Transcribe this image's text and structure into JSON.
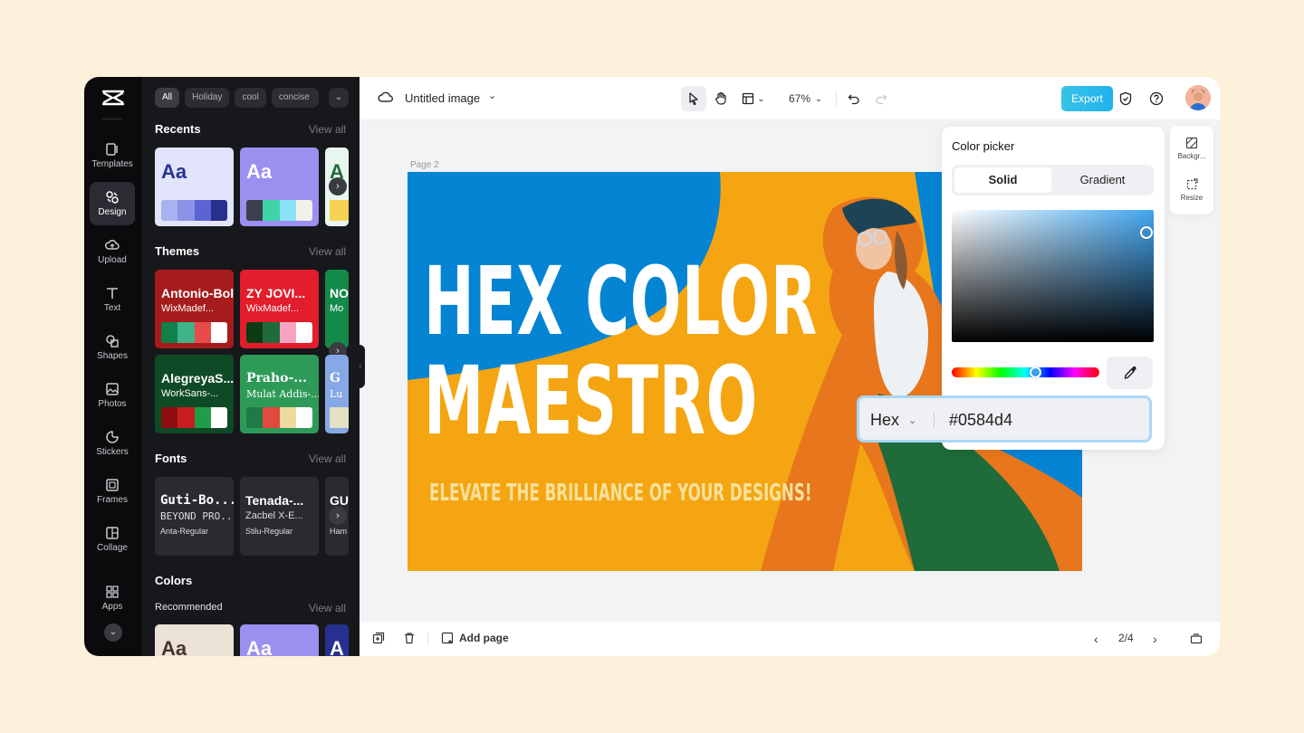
{
  "rail": {
    "items": [
      {
        "label": "Templates",
        "icon": "templates-icon"
      },
      {
        "label": "Design",
        "icon": "design-icon",
        "active": true
      },
      {
        "label": "Upload",
        "icon": "upload-icon"
      },
      {
        "label": "Text",
        "icon": "text-icon"
      },
      {
        "label": "Shapes",
        "icon": "shapes-icon"
      },
      {
        "label": "Photos",
        "icon": "photos-icon"
      },
      {
        "label": "Stickers",
        "icon": "stickers-icon"
      },
      {
        "label": "Frames",
        "icon": "frames-icon"
      },
      {
        "label": "Collage",
        "icon": "collage-icon"
      },
      {
        "label": "Apps",
        "icon": "apps-icon"
      }
    ]
  },
  "panel": {
    "chips": [
      "All",
      "Holiday",
      "cool",
      "concise"
    ],
    "view_all": "View all",
    "recents": {
      "title": "Recents",
      "cards": [
        {
          "aa": "Aa",
          "colors": [
            "#a9b2f0",
            "#8a93e8",
            "#5a64d4",
            "#27308f"
          ]
        },
        {
          "aa": "Aa",
          "colors": [
            "#3a3f4e",
            "#3fd3a6",
            "#8ce0f5",
            "#f1f0ea"
          ]
        },
        {
          "aa": "A"
        }
      ]
    },
    "themes": {
      "title": "Themes",
      "cards": [
        {
          "font_a": "Antonio-Bold",
          "font_b": "WixMadef...",
          "colors": [
            "#12804a",
            "#3fb38a",
            "#e94b4b",
            "#ffffff"
          ]
        },
        {
          "font_a": "ZY JOVI...",
          "font_b": "WixMadef...",
          "colors": [
            "#0c3b13",
            "#1f6b3a",
            "#f7a4c4",
            "#ffffff"
          ]
        },
        {
          "font_a": "NO",
          "font_b": "Mo"
        },
        {
          "font_a": "AlegreyaS...",
          "font_b": "WorkSans-...",
          "colors": [
            "#8f0e12",
            "#c81d1d",
            "#1f9e4a",
            "#ffffff"
          ]
        },
        {
          "font_a": "Praho-...",
          "font_b": "Mulat Addis-...",
          "colors": [
            "#1f7a45",
            "#e14a3c",
            "#efd9a0",
            "#ffffff"
          ]
        },
        {
          "font_a": "G",
          "font_b": "Lu"
        }
      ]
    },
    "fonts": {
      "title": "Fonts",
      "cards": [
        {
          "a": "Guti-Bo...",
          "b": "BEYOND PRO...",
          "c": "Anta-Regular"
        },
        {
          "a": "Tenada-...",
          "b": "Zacbel X-E...",
          "c": "Stilu-Regular"
        },
        {
          "a": "GU",
          "b": "",
          "c": "Ham"
        }
      ]
    },
    "colors": {
      "title": "Colors",
      "subtitle": "Recommended",
      "cards": [
        {
          "aa": "Aa"
        },
        {
          "aa": "Aa"
        },
        {
          "aa": "A"
        }
      ]
    }
  },
  "topbar": {
    "doc_title": "Untitled image",
    "zoom": "67%",
    "export_label": "Export"
  },
  "canvas": {
    "page_label": "Page 2",
    "headline_1": "HEX COLOR",
    "headline_2": "MAESTRO",
    "tagline": "ELEVATE THE BRILLIANCE OF YOUR DESIGNS!",
    "colors": {
      "blue": "#0584d4",
      "orange": "#f4a511",
      "coat": "#e7761d"
    }
  },
  "color_picker": {
    "title": "Color picker",
    "tabs": [
      "Solid",
      "Gradient"
    ],
    "active_tab": "Solid",
    "mode": "Hex",
    "value": "#0584d4"
  },
  "sidetools": [
    {
      "label": "Backgr...",
      "icon": "background-icon"
    },
    {
      "label": "Resize",
      "icon": "resize-icon"
    }
  ],
  "bottombar": {
    "add_page": "Add page",
    "pagination": "2/4"
  }
}
